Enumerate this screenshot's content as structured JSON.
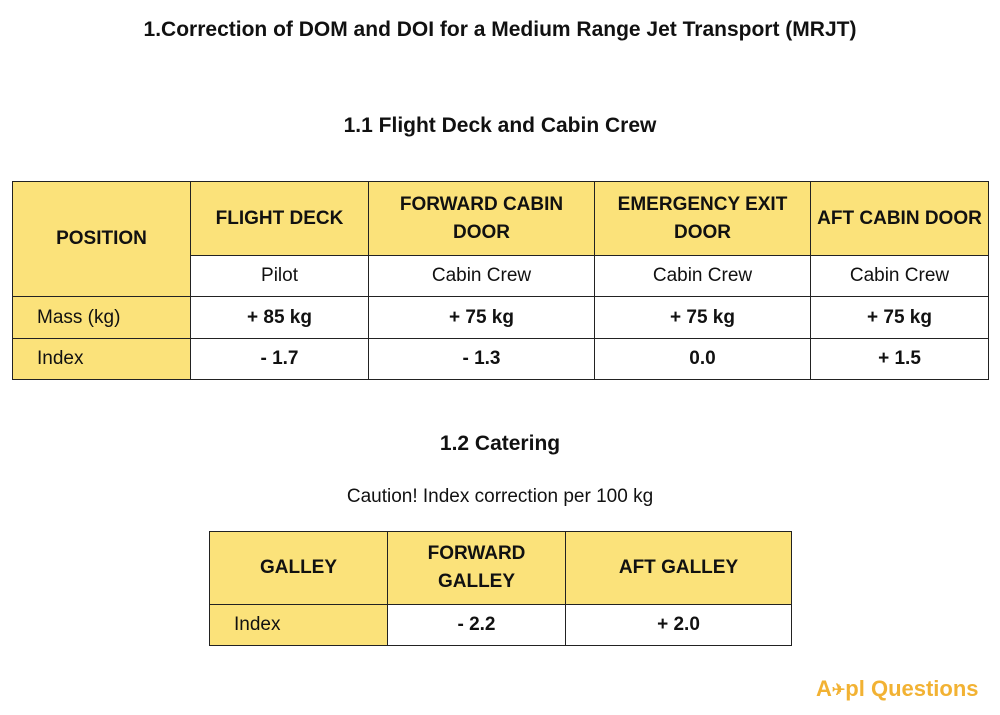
{
  "title": "1.Correction of DOM and DOI for a Medium Range Jet Transport (MRJT)",
  "section1": {
    "heading": "1.1 Flight Deck and Cabin Crew",
    "position_header": "POSITION",
    "columns": [
      {
        "header": "FLIGHT DECK",
        "sub": "Pilot",
        "mass": "+ 85 kg",
        "index": "-  1.7"
      },
      {
        "header": "FORWARD CABIN DOOR",
        "sub": "Cabin Crew",
        "mass": "+ 75 kg",
        "index": "-  1.3"
      },
      {
        "header": "EMERGENCY EXIT DOOR",
        "sub": "Cabin Crew",
        "mass": "+ 75 kg",
        "index": "0.0"
      },
      {
        "header": "AFT CABIN DOOR",
        "sub": "Cabin Crew",
        "mass": "+ 75 kg",
        "index": "+ 1.5"
      }
    ],
    "mass_label": "Mass (kg)",
    "index_label": "Index"
  },
  "section2": {
    "heading": "1.2 Catering",
    "caution": "Caution! Index correction per 100 kg",
    "galley_header": "GALLEY",
    "columns": [
      {
        "header": "FORWARD GALLEY",
        "index": "-  2.2"
      },
      {
        "header": "AFT GALLEY",
        "index": "+ 2.0"
      }
    ],
    "index_label": "Index"
  },
  "logo": {
    "text_a": "A",
    "icon": "airplane-icon",
    "text_b": "pl Questions",
    "color": "#f2b233"
  },
  "colors": {
    "header_bg": "#fbe27a",
    "border": "#222222"
  }
}
